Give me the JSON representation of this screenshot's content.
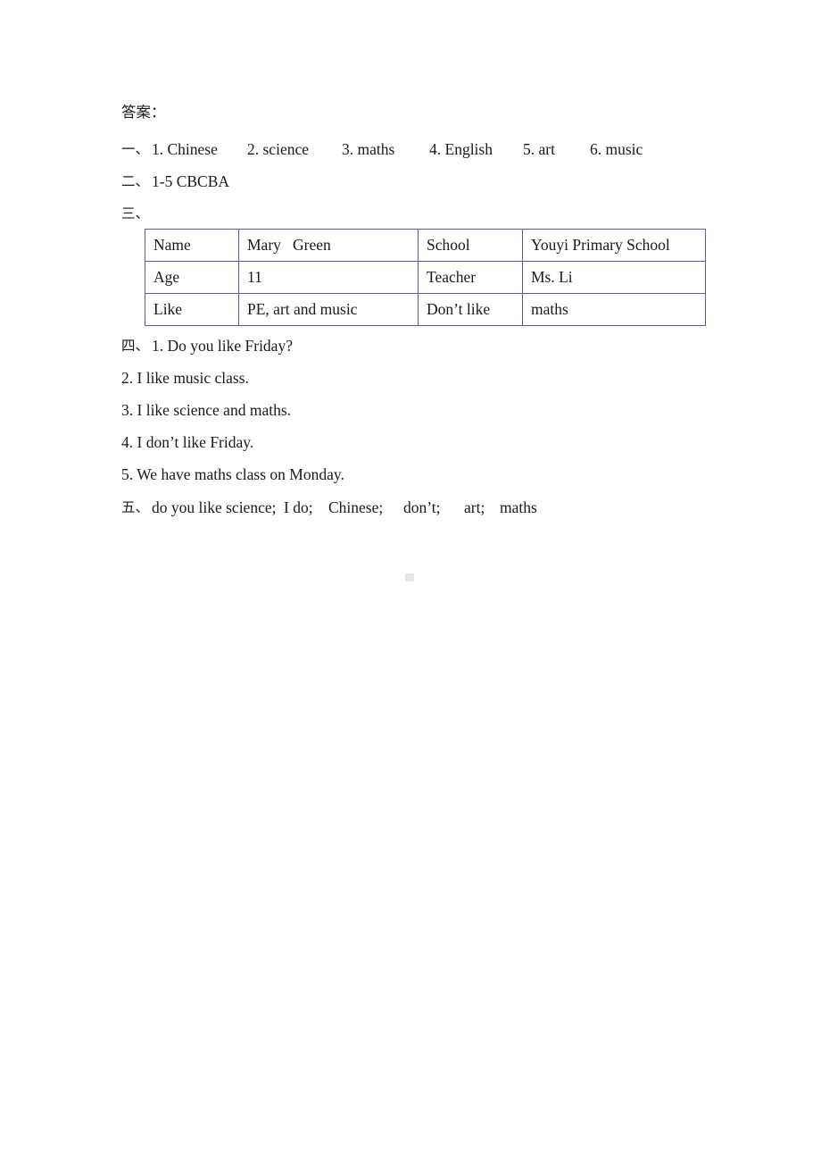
{
  "document": {
    "heading": "答案：",
    "sections": [
      {
        "marker": "一、",
        "items": [
          "1. Chinese",
          "2. science",
          "3. maths",
          "4. English",
          "5. art",
          "6. music"
        ]
      },
      {
        "marker": "二、",
        "text": "1-5 CBCBA"
      },
      {
        "marker": "三、",
        "text": ""
      },
      {
        "marker": "四、",
        "items": [
          "1. Do you like Friday?",
          "2. I like music class.",
          "3. I like science and maths.",
          "4. I don’t like Friday.",
          "5. We have maths class on Monday."
        ]
      },
      {
        "marker": "五、",
        "items": [
          "do you like science;",
          "I do;",
          "Chinese;",
          "don’t;",
          "art;",
          "maths"
        ]
      }
    ]
  },
  "info_table": {
    "border_color": "#5b5ba8",
    "rows": [
      {
        "label_left": "Name",
        "value_left": "Mary   Green",
        "label_right": "School",
        "value_right": "Youyi Primary School"
      },
      {
        "label_left": "Age",
        "value_left": "11",
        "label_right": "Teacher",
        "value_right": "Ms. Li"
      },
      {
        "label_left": "Like",
        "value_left": "PE, art and music",
        "label_right": "Don’t like",
        "value_right": "maths"
      }
    ]
  }
}
